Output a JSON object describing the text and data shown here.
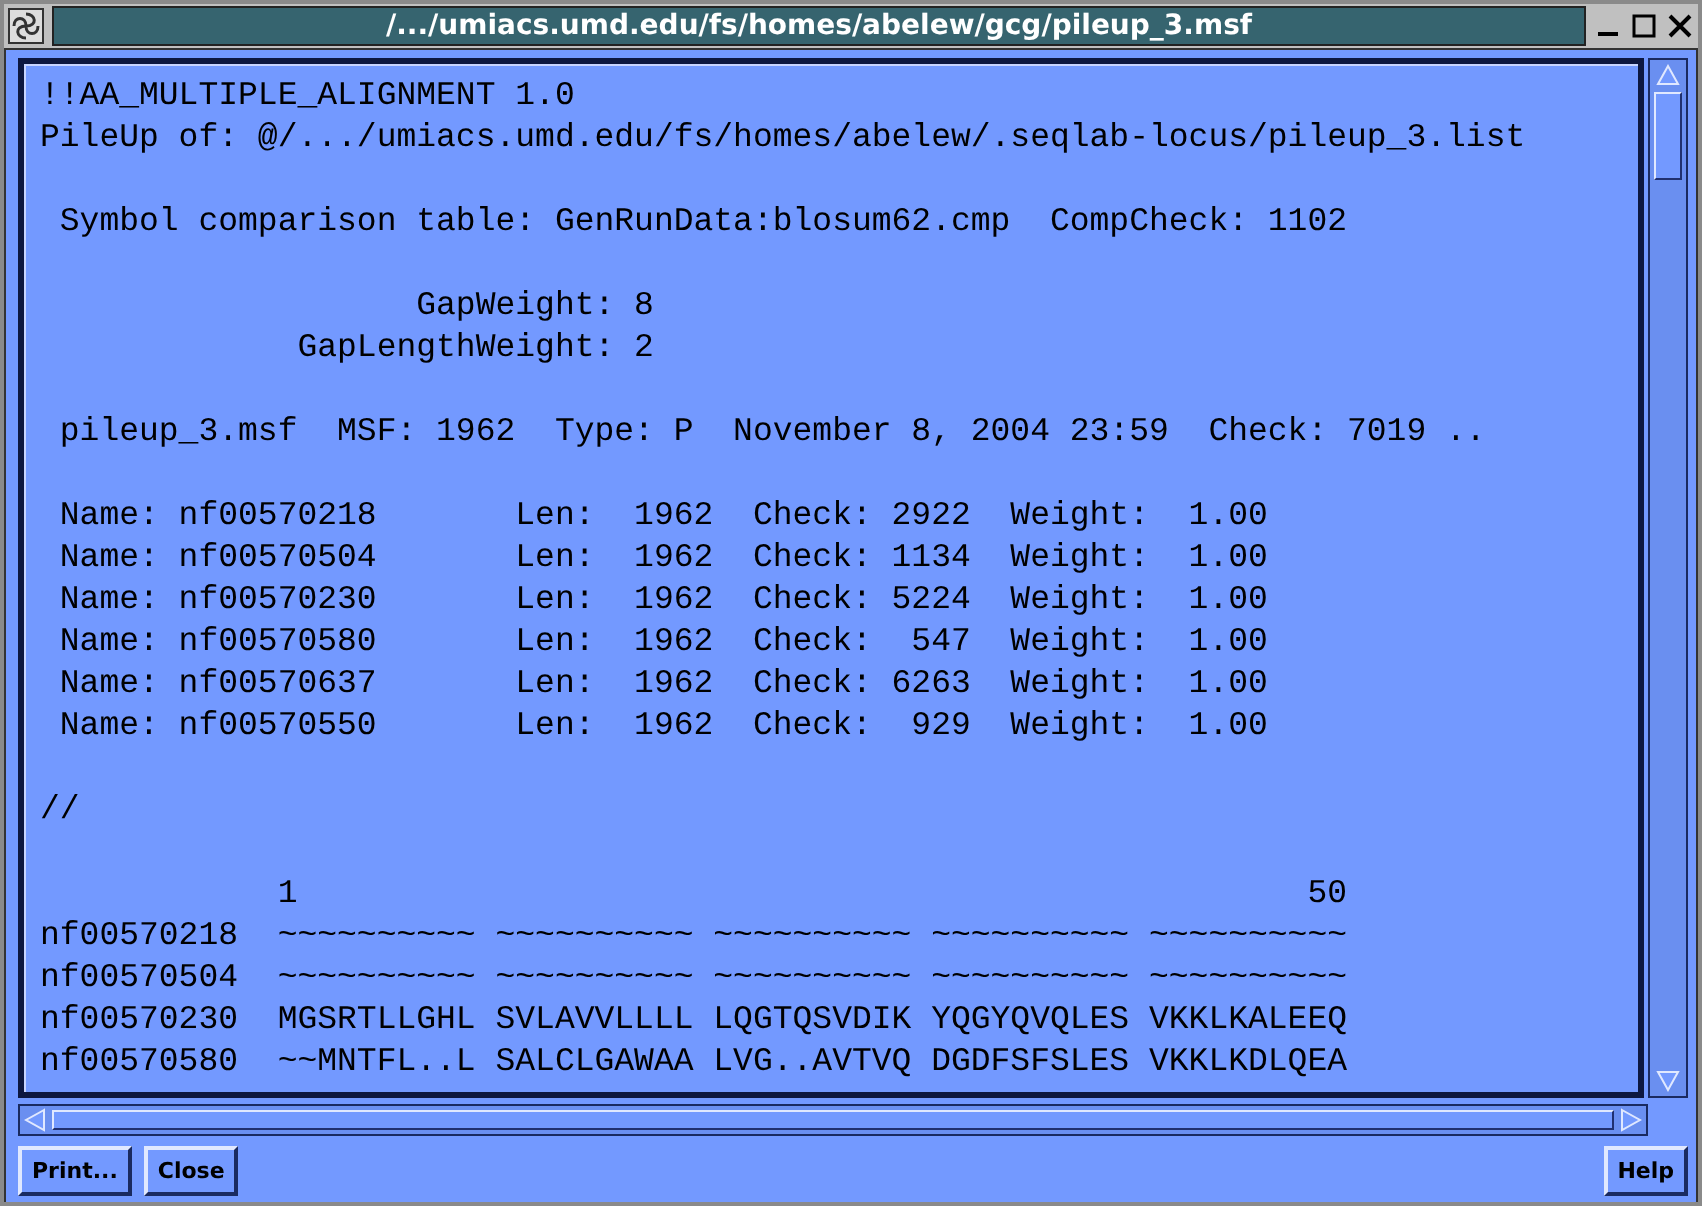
{
  "window": {
    "title": "/.../umiacs.umd.edu/fs/homes/abelew/gcg/pileup_3.msf"
  },
  "document": {
    "paragraphs": [
      [
        "!!AA_MULTIPLE_ALIGNMENT 1.0",
        "PileUp of: @/.../umiacs.umd.edu/fs/homes/abelew/.seqlab-locus/pileup_3.list"
      ],
      [
        " Symbol comparison table: GenRunData:blosum62.cmp  CompCheck: 1102"
      ],
      [
        "                   GapWeight: 8",
        "             GapLengthWeight: 2"
      ],
      [
        " pileup_3.msf  MSF: 1962  Type: P  November 8, 2004 23:59  Check: 7019 .."
      ],
      [
        " Name: nf00570218       Len:  1962  Check: 2922  Weight:  1.00",
        " Name: nf00570504       Len:  1962  Check: 1134  Weight:  1.00",
        " Name: nf00570230       Len:  1962  Check: 5224  Weight:  1.00",
        " Name: nf00570580       Len:  1962  Check:  547  Weight:  1.00",
        " Name: nf00570637       Len:  1962  Check: 6263  Weight:  1.00",
        " Name: nf00570550       Len:  1962  Check:  929  Weight:  1.00"
      ],
      [
        "//"
      ],
      [
        "            1                                                   50",
        "nf00570218  ~~~~~~~~~~ ~~~~~~~~~~ ~~~~~~~~~~ ~~~~~~~~~~ ~~~~~~~~~~",
        "nf00570504  ~~~~~~~~~~ ~~~~~~~~~~ ~~~~~~~~~~ ~~~~~~~~~~ ~~~~~~~~~~",
        "nf00570230  MGSRTLLGHL SVLAVVLLLL LQGTQSVDIK YQGYQVQLES VKKLKALEEQ",
        "nf00570580  ~~MNTFL..L SALCLGAWAA LVG..AVTVQ DGDFSFSLES VKKLKDLQEA"
      ]
    ]
  },
  "buttons_left": [
    {
      "label": "Print..."
    },
    {
      "label": "Close"
    }
  ],
  "buttons_right": [
    {
      "label": "Help"
    }
  ]
}
